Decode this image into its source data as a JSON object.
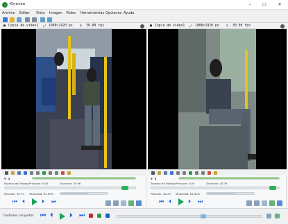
{
  "app": {
    "title": "Kinovea"
  },
  "window": {
    "minimize": "–",
    "maximize": "□",
    "close": "✕"
  },
  "menu": [
    "Archivo",
    "Editar",
    "Vista",
    "Imagen",
    "Video",
    "Herramientas",
    "Opciones",
    "Ayuda"
  ],
  "left_panel": {
    "file_name": "Copia de video1",
    "resolution": "1080×1920 px",
    "fps": "30.00 fps",
    "espacio_label": "Espacio de Trabajo",
    "principio": "Principio: 0:00",
    "duracion": "Duración: 30.96",
    "posicion": "Posición: 30.73",
    "velocidad": "Velocidad: 61.00%"
  },
  "right_panel": {
    "file_name": "Copia de video1",
    "resolution": "1080×1920 px",
    "fps": "30.00 fps",
    "espacio_label": "Espacio de Trabajo",
    "principio": "Principio: 0:00",
    "duracion": "Duración: 44.79",
    "posicion": "Posición: 44.29",
    "velocidad": "Velocidad: 61.00%"
  },
  "bottom": {
    "label": "Controles conjuntos"
  },
  "colors": {
    "accent": "#19a35b",
    "pause": "#1a5fd0",
    "stop": "#c52a2a"
  }
}
